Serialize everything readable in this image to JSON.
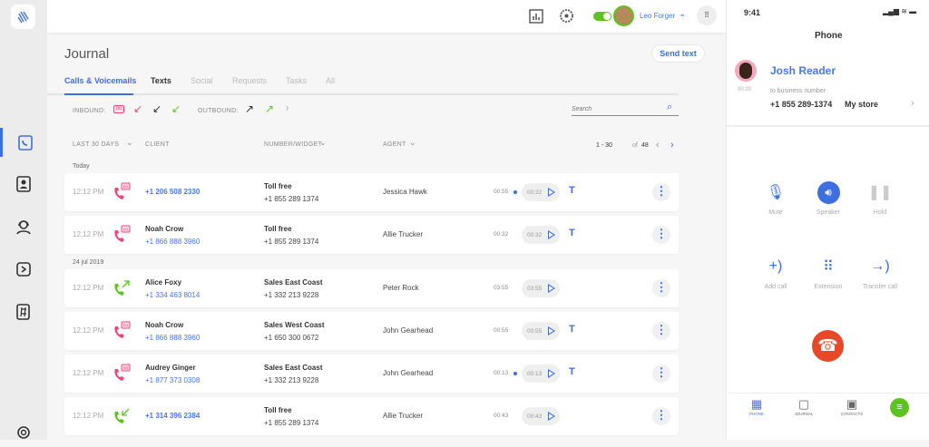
{
  "header": {
    "user_name": "Leo Forger",
    "toggle_on": true
  },
  "journal": {
    "title": "Journal",
    "send_text": "Send text",
    "tabs": [
      {
        "label": "Calls & Voicemails",
        "state": "active"
      },
      {
        "label": "Texts",
        "state": "normal"
      },
      {
        "label": "Social",
        "state": "disabled"
      },
      {
        "label": "Requests",
        "state": "disabled"
      },
      {
        "label": "Tasks",
        "state": "disabled"
      },
      {
        "label": "All",
        "state": "disabled"
      }
    ],
    "filters": {
      "inbound_label": "INBOUND:",
      "outbound_label": "OUTBOUND:"
    },
    "search_placeholder": "Search",
    "columns": {
      "period": "LAST 30 DAYS",
      "client": "CLIENT",
      "number": "NUMBER/WIDGET",
      "agent": "AGENT"
    },
    "pagination": {
      "range": "1 - 30",
      "of": "of",
      "total": "48"
    },
    "groups": [
      {
        "date": "Today"
      },
      {
        "date": "24 jul 2019"
      }
    ],
    "rows": [
      {
        "time": "12:12 PM",
        "type": "voicemail",
        "client_name": "",
        "client_number": "+1 206 508 2330",
        "widget": "Toll free",
        "widget_number": "+1 855 289 1374",
        "agent": "Jessica Hawk",
        "duration": "00:55",
        "unread": true,
        "pill": "00:32",
        "transcript": "T"
      },
      {
        "time": "12:12 PM",
        "type": "voicemail",
        "client_name": "Noah Crow",
        "client_number": "+1 866 888 3960",
        "widget": "Toll free",
        "widget_number": "+1 855 289 1374",
        "agent": "Allie Trucker",
        "duration": "00:32",
        "unread": false,
        "pill": "00:32",
        "transcript": "T"
      },
      {
        "time": "12:12 PM",
        "type": "outbound",
        "client_name": "Alice Foxy",
        "client_number": "+1 334 463 8014",
        "widget": "Sales East Coast",
        "widget_number": "+1 332 213 9228",
        "agent": "Peter Rock",
        "duration": "03:55",
        "unread": false,
        "pill": "03:55",
        "transcript": ""
      },
      {
        "time": "12:12 PM",
        "type": "voicemail",
        "client_name": "Noah Crow",
        "client_number": "+1 866 888 3960",
        "widget": "Sales West Coast",
        "widget_number": "+1 650 300 0672",
        "agent": "John Gearhead",
        "duration": "00:55",
        "unread": false,
        "pill": "00:55",
        "transcript": "T"
      },
      {
        "time": "12:12 PM",
        "type": "voicemail",
        "client_name": "Audrey Ginger",
        "client_number": "+1 877 373 0308",
        "widget": "Sales East Coast",
        "widget_number": "+1 332 213 9228",
        "agent": "John Gearhead",
        "duration": "00:13",
        "unread": true,
        "pill": "00:13",
        "transcript": "T"
      },
      {
        "time": "12:12 PM",
        "type": "inbound",
        "client_name": "",
        "client_number": "+1 314 396 2384",
        "widget": "Toll free",
        "widget_number": "+1 855 289 1374",
        "agent": "Allie Trucker",
        "duration": "00:43",
        "unread": false,
        "pill": "00:43",
        "transcript": ""
      }
    ]
  },
  "phone": {
    "clock": "9:41",
    "title": "Phone",
    "caller": "Josh Reader",
    "call_time": "00:20",
    "to_label": "to business number",
    "business_number": "+1 855 289-1374",
    "business_name": "My store",
    "controls": [
      "Mute",
      "Speaker",
      "Hold",
      "Add call",
      "Extension",
      "Transfer call"
    ],
    "nav": [
      "PHONE",
      "JOURNAL",
      "CONTACTS"
    ]
  },
  "colors": {
    "accent": "#3e6fe0",
    "voicemail": "#f0457a",
    "green": "#5cc41d",
    "hangup": "#e8482a"
  }
}
